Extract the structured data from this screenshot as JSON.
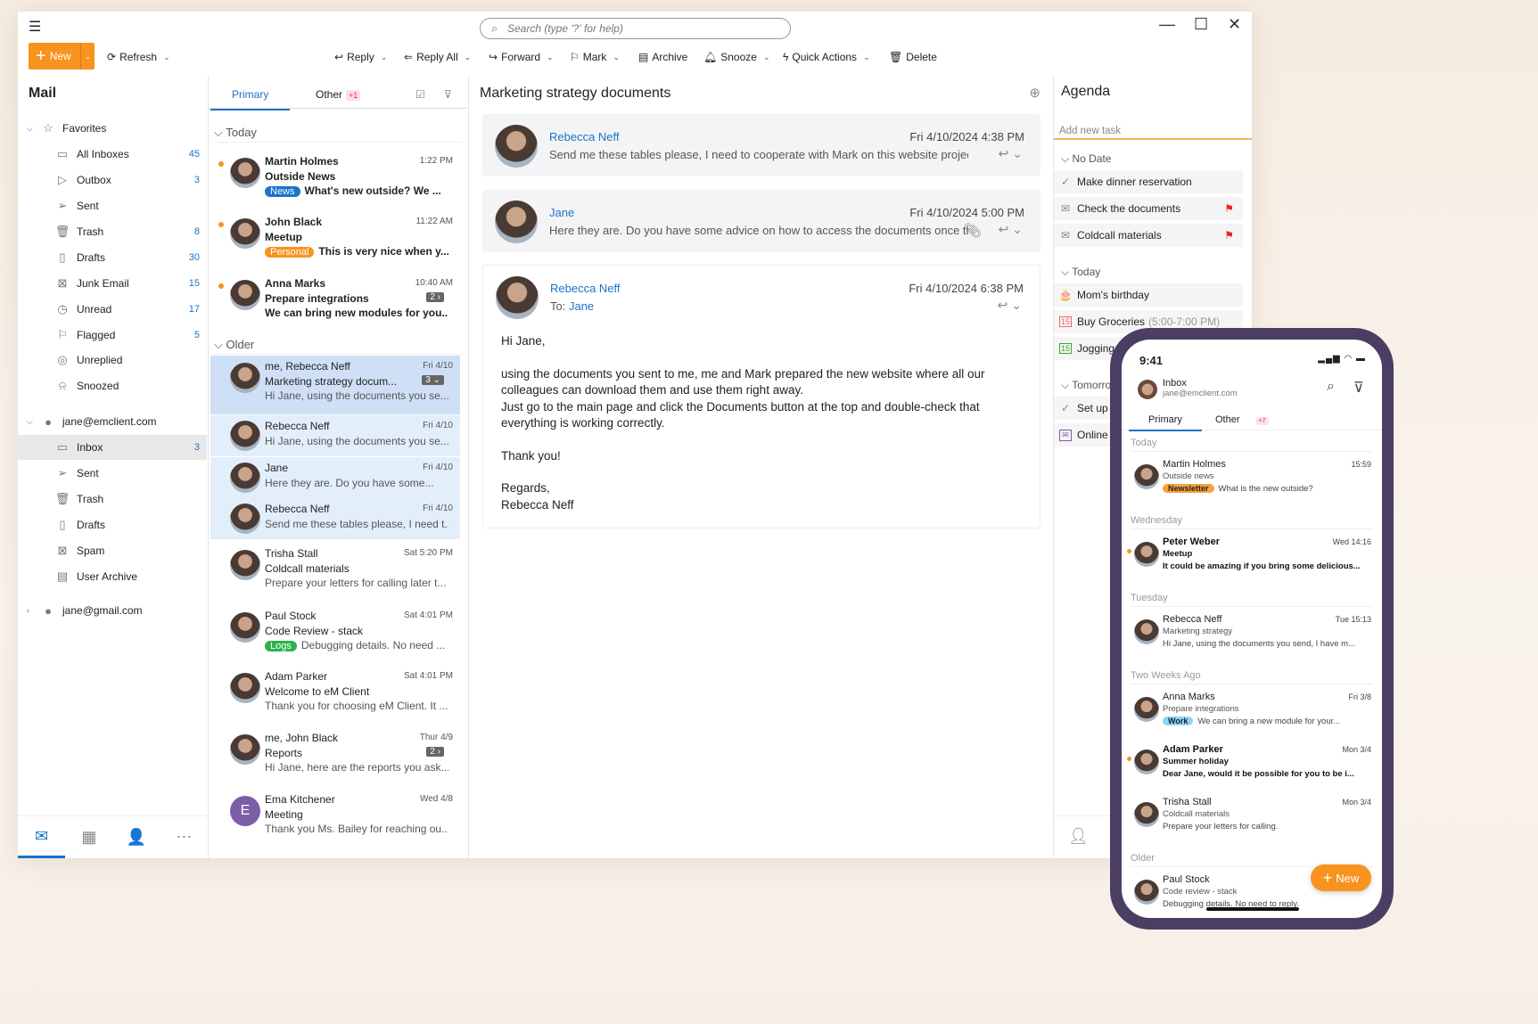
{
  "colors": {
    "accent": "#f7931e",
    "link": "#1a73c8",
    "phone_frame": "#4a3f62",
    "selected": "#cfe0f6"
  },
  "titlebar": {
    "search_placeholder": "Search (type '?' for help)",
    "menu_icon": "hamburger-icon"
  },
  "toolbar": {
    "new": "New",
    "refresh": "Refresh",
    "reply": "Reply",
    "reply_all": "Reply All",
    "forward": "Forward",
    "mark": "Mark",
    "archive": "Archive",
    "snooze": "Snooze",
    "quick_actions": "Quick Actions",
    "delete": "Delete"
  },
  "sidebar": {
    "title": "Mail",
    "items": [
      {
        "label": "Favorites",
        "icon": "☆",
        "arrow": "⌵",
        "indent": 0
      },
      {
        "label": "All Inboxes",
        "icon": "▭",
        "count": "45",
        "indent": 1
      },
      {
        "label": "Outbox",
        "icon": "▷",
        "count": "3",
        "indent": 1
      },
      {
        "label": "Sent",
        "icon": "➢",
        "indent": 1
      },
      {
        "label": "Trash",
        "icon": "🗑",
        "count": "8",
        "indent": 1
      },
      {
        "label": "Drafts",
        "icon": "▯",
        "count": "30",
        "indent": 1
      },
      {
        "label": "Junk Email",
        "icon": "⊠",
        "count": "15",
        "indent": 1
      },
      {
        "label": "Unread",
        "icon": "◷",
        "count": "17",
        "indent": 1
      },
      {
        "label": "Flagged",
        "icon": "⚐",
        "count": "5",
        "indent": 1
      },
      {
        "label": "Unreplied",
        "icon": "◎",
        "indent": 1
      },
      {
        "label": "Snoozed",
        "icon": "⍾",
        "indent": 1
      },
      {
        "label": "jane@emclient.com",
        "icon": "●",
        "arrow": "⌵",
        "indent": 0
      },
      {
        "label": "Inbox",
        "icon": "▭",
        "count": "3",
        "indent": 1,
        "selected": true
      },
      {
        "label": "Sent",
        "icon": "➢",
        "indent": 1
      },
      {
        "label": "Trash",
        "icon": "🗑",
        "indent": 1
      },
      {
        "label": "Drafts",
        "icon": "▯",
        "indent": 1
      },
      {
        "label": "Spam",
        "icon": "⊠",
        "indent": 1
      },
      {
        "label": "User Archive",
        "icon": "▤",
        "indent": 1
      },
      {
        "label": "jane@gmail.com",
        "icon": "●",
        "arrow": "›",
        "indent": 0
      }
    ],
    "bottom": [
      "✉",
      "▦",
      "👤",
      "⋯"
    ]
  },
  "list": {
    "tab_primary": "Primary",
    "tab_other": "Other",
    "other_badge": "+1",
    "group_today": "Today",
    "group_older": "Older",
    "messages": [
      {
        "from": "Martin Holmes",
        "time": "1:22 PM",
        "subject": "Outside News",
        "tag": "News",
        "tag_color": "#1a73c8",
        "preview": "What's new outside? We ...",
        "unread": true
      },
      {
        "from": "John Black",
        "time": "11:22 AM",
        "subject": "Meetup",
        "tag": "Personal",
        "tag_color": "#f7931e",
        "preview": "This is very nice when y...",
        "unread": true
      },
      {
        "from": "Anna Marks",
        "time": "10:40 AM",
        "subject": "Prepare integrations",
        "preview": "We can bring new modules for you...",
        "count": "2 ›",
        "unread": true
      },
      {
        "from": "me, Rebecca Neff",
        "time": "Fri 4/10",
        "subject": "Marketing strategy docum...",
        "preview": "Hi Jane, using the documents you se...",
        "count": "3 ⌄",
        "state": "sel"
      },
      {
        "from": "Rebecca Neff",
        "time": "Fri 4/10",
        "preview": "Hi Jane, using the documents you se...",
        "state": "hl"
      },
      {
        "from": "Jane",
        "time": "Fri 4/10",
        "preview": "Here they are. Do you have some...",
        "state": "hl"
      },
      {
        "from": "Rebecca Neff",
        "time": "Fri 4/10",
        "preview": "Send me these tables please, I need t...",
        "state": "hl"
      },
      {
        "from": "Trisha Stall",
        "time": "Sat 5:20 PM",
        "subject": "Coldcall materials",
        "preview": "Prepare your letters for calling later t..."
      },
      {
        "from": "Paul Stock",
        "time": "Sat 4:01 PM",
        "subject": "Code Review - stack",
        "tag": "Logs",
        "tag_color": "#2bb24c",
        "preview": "Debugging details. No need ..."
      },
      {
        "from": "Adam Parker",
        "time": "Sat 4:01 PM",
        "subject": "Welcome to eM Client",
        "preview": "Thank you for choosing eM Client. It ..."
      },
      {
        "from": "me, John Black",
        "time": "Thur 4/9",
        "subject": "Reports",
        "preview": "Hi Jane, here are the reports you ask...",
        "count": "2 ›"
      },
      {
        "from": "Ema Kitchener",
        "time": "Wed 4/8",
        "subject": "Meeting",
        "preview": "Thank you Ms. Bailey for reaching ou...",
        "initial": "E"
      }
    ]
  },
  "reader": {
    "title": "Marketing strategy documents",
    "cards": [
      {
        "name": "Rebecca Neff",
        "date": "Fri 4/10/2024 4:38 PM",
        "preview": "Send me these tables please, I need to cooperate with Mark on this website project..."
      },
      {
        "name": "Jane",
        "date": "Fri 4/10/2024 5:00 PM",
        "preview": "Here they are. Do you have some advice on how to access the documents once th..."
      },
      {
        "name": "Rebecca Neff",
        "date": "Fri 4/10/2024 6:38 PM",
        "to_label": "To:",
        "to": "Jane"
      }
    ],
    "body": [
      "Hi Jane,",
      "using the documents you sent to me, me and Mark prepared the new website where all our colleagues can download them and use them right away.\nJust go to the main page and click the Documents button at the top and double-check that everything is working correctly.",
      "Thank you!",
      "Regards,\nRebecca Neff"
    ]
  },
  "agenda": {
    "title": "Agenda",
    "add_placeholder": "Add new task",
    "groups": [
      {
        "label": "No Date",
        "items": [
          {
            "label": "Make dinner reservation",
            "icon": "✓"
          },
          {
            "label": "Check the documents",
            "icon": "✉",
            "flag": true
          },
          {
            "label": "Coldcall materials",
            "icon": "✉",
            "flag": true
          }
        ]
      },
      {
        "label": "Today",
        "items": [
          {
            "label": "Mom's birthday",
            "icon": "🎂"
          },
          {
            "label": "Buy Groceries",
            "time": "(5:00-7:00 PM)",
            "icon": "15",
            "icon_color": "#e66"
          },
          {
            "label": "Jogging",
            "icon": "15",
            "icon_color": "#3a3"
          }
        ]
      },
      {
        "label": "Tomorrow",
        "items": [
          {
            "label": "Set up",
            "icon": "✓"
          },
          {
            "label": "Online",
            "icon": "✉",
            "icon_color": "#7b5ea7"
          }
        ]
      }
    ]
  },
  "phone": {
    "time": "9:41",
    "inbox": "Inbox",
    "email": "jane@emclient.com",
    "tab_primary": "Primary",
    "tab_other": "Other",
    "other_badge": "+7",
    "new": "New",
    "sections": [
      {
        "label": "Today",
        "messages": [
          {
            "from": "Martin Holmes",
            "time": "15:59",
            "subject": "Outside news",
            "tag": "Newsletter",
            "tag_color": "#f9a23c",
            "preview": "What is the new outside?"
          }
        ]
      },
      {
        "label": "Wednesday",
        "messages": [
          {
            "from": "Peter Weber",
            "time": "Wed 14:16",
            "subject": "Meetup",
            "preview": "It could be amazing if you bring some delicious...",
            "unread": true
          }
        ]
      },
      {
        "label": "Tuesday",
        "messages": [
          {
            "from": "Rebecca Neff",
            "time": "Tue 15:13",
            "subject": "Marketing strategy",
            "preview": "Hi Jane, using the documents you send, I have m..."
          }
        ]
      },
      {
        "label": "Two Weeks Ago",
        "messages": [
          {
            "from": "Anna Marks",
            "time": "Fri 3/8",
            "subject": "Prepare integrations",
            "tag": "Work",
            "tag_color": "#8fd3fb",
            "preview": "We can bring a new module for your..."
          },
          {
            "from": "Adam Parker",
            "time": "Mon 3/4",
            "subject": "Summer holiday",
            "preview": "Dear Jane, would it be possible for you to be i...",
            "unread": true
          },
          {
            "from": "Trisha Stall",
            "time": "Mon 3/4",
            "subject": "Coldcall materials",
            "preview": "Prepare your letters for calling."
          }
        ]
      },
      {
        "label": "Older",
        "messages": [
          {
            "from": "Paul Stock",
            "subject": "Code review - stack",
            "preview": "Debugging details. No need to reply."
          }
        ]
      }
    ]
  }
}
